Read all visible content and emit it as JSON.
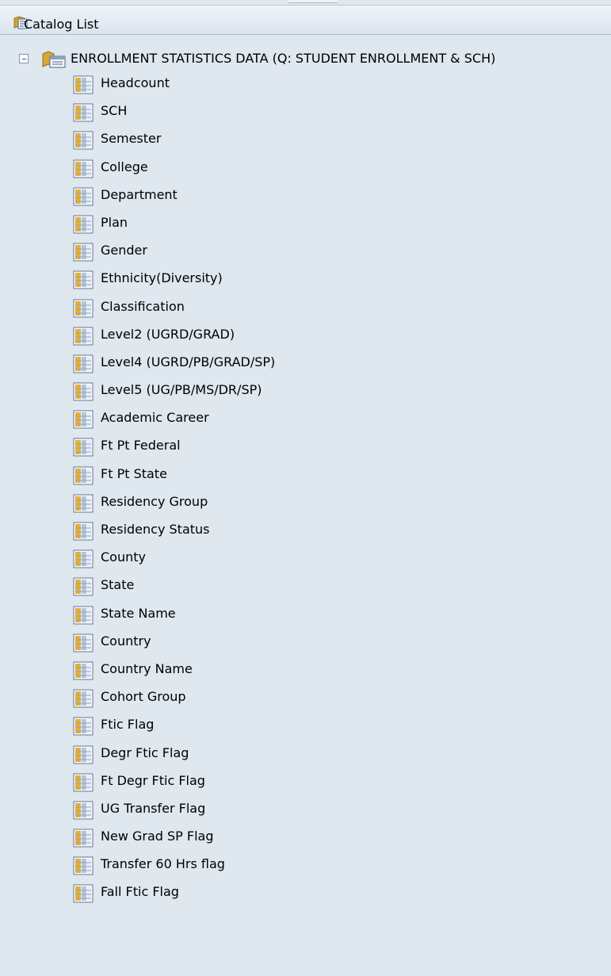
{
  "header": {
    "title": "Catalog List",
    "icon": "catalog-icon"
  },
  "tree": {
    "root": {
      "label": "ENROLLMENT STATISTICS DATA (Q: STUDENT ENROLLMENT & SCH)",
      "expanded": true,
      "toggle_icon": "collapse-icon",
      "icon": "catalog-folder-icon"
    },
    "items": [
      {
        "label": "Headcount"
      },
      {
        "label": "SCH"
      },
      {
        "label": "Semester"
      },
      {
        "label": "College"
      },
      {
        "label": "Department"
      },
      {
        "label": "Plan"
      },
      {
        "label": "Gender"
      },
      {
        "label": "Ethnicity(Diversity)"
      },
      {
        "label": "Classification"
      },
      {
        "label": "Level2 (UGRD/GRAD)"
      },
      {
        "label": "Level4 (UGRD/PB/GRAD/SP)"
      },
      {
        "label": "Level5 (UG/PB/MS/DR/SP)"
      },
      {
        "label": "Academic Career"
      },
      {
        "label": "Ft Pt Federal"
      },
      {
        "label": "Ft Pt State"
      },
      {
        "label": "Residency Group"
      },
      {
        "label": "Residency Status"
      },
      {
        "label": "County"
      },
      {
        "label": "State"
      },
      {
        "label": "State Name"
      },
      {
        "label": "Country"
      },
      {
        "label": "Country Name"
      },
      {
        "label": "Cohort Group"
      },
      {
        "label": "Ftic Flag"
      },
      {
        "label": "Degr Ftic Flag"
      },
      {
        "label": "Ft Degr Ftic Flag"
      },
      {
        "label": "UG Transfer Flag"
      },
      {
        "label": "New Grad SP Flag"
      },
      {
        "label": "Transfer 60 Hrs flag"
      },
      {
        "label": "Fall Ftic Flag"
      }
    ]
  }
}
